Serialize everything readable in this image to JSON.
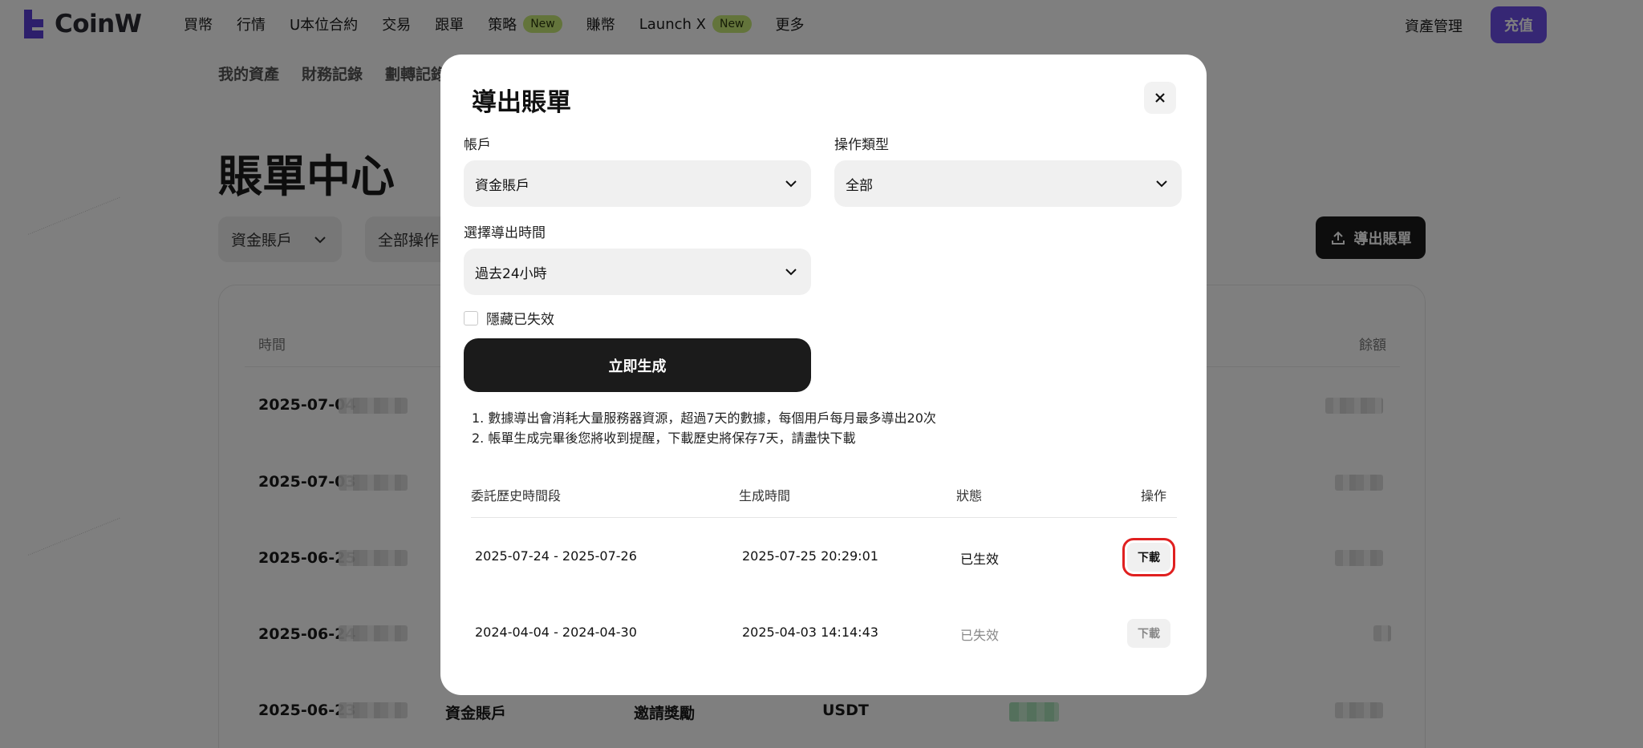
{
  "brand": {
    "name": "CoinW"
  },
  "nav": {
    "items": [
      {
        "label": "買幣"
      },
      {
        "label": "行情"
      },
      {
        "label": "U本位合約"
      },
      {
        "label": "交易"
      },
      {
        "label": "跟單"
      },
      {
        "label": "策略",
        "badge": "New"
      },
      {
        "label": "賺幣"
      },
      {
        "label": "Launch X",
        "badge": "New"
      },
      {
        "label": "更多"
      }
    ],
    "asset_management": "資產管理",
    "deposit": "充值"
  },
  "subnav": [
    "我的資產",
    "財務記錄",
    "劃轉記錄"
  ],
  "page": {
    "title": "賬單中心",
    "filter_account": "資金賬戶",
    "filter_type": "全部操作",
    "export_button": "導出賬單",
    "table_headers": {
      "time": "時間",
      "balance": "餘額"
    },
    "rows": [
      {
        "date": "2025-07-04"
      },
      {
        "date": "2025-07-03"
      },
      {
        "date": "2025-06-25"
      },
      {
        "date": "2025-06-24"
      },
      {
        "date": "2025-06-23",
        "account": "資金賬戶",
        "type": "邀請獎勵",
        "coin": "USDT"
      }
    ]
  },
  "modal": {
    "title": "導出賬單",
    "account_label": "帳戶",
    "account_value": "資金賬戶",
    "type_label": "操作類型",
    "type_value": "全部",
    "time_label": "選擇導出時間",
    "time_value": "過去24小時",
    "hide_expired_label": "隱藏已失效",
    "generate_button": "立即生成",
    "notes": [
      "1. 數據導出會消耗大量服務器資源，超過7天的數據，每個用戶每月最多導出20次",
      "2. 帳單生成完畢後您將收到提醒，下載歷史將保存7天，請盡快下載"
    ],
    "history_headers": {
      "period": "委託歷史時間段",
      "generated": "生成時間",
      "status": "狀態",
      "action": "操作"
    },
    "history": [
      {
        "period": "2025-07-24 - 2025-07-26",
        "generated": "2025-07-25 20:29:01",
        "status": "已生效",
        "action": "下載"
      },
      {
        "period": "2024-04-04 - 2024-04-30",
        "generated": "2025-04-03 14:14:43",
        "status": "已失效",
        "action": "下載"
      }
    ]
  },
  "colors": {
    "accent": "#6c4ee8",
    "badge": "#c7e876",
    "highlight": "#e02020"
  }
}
